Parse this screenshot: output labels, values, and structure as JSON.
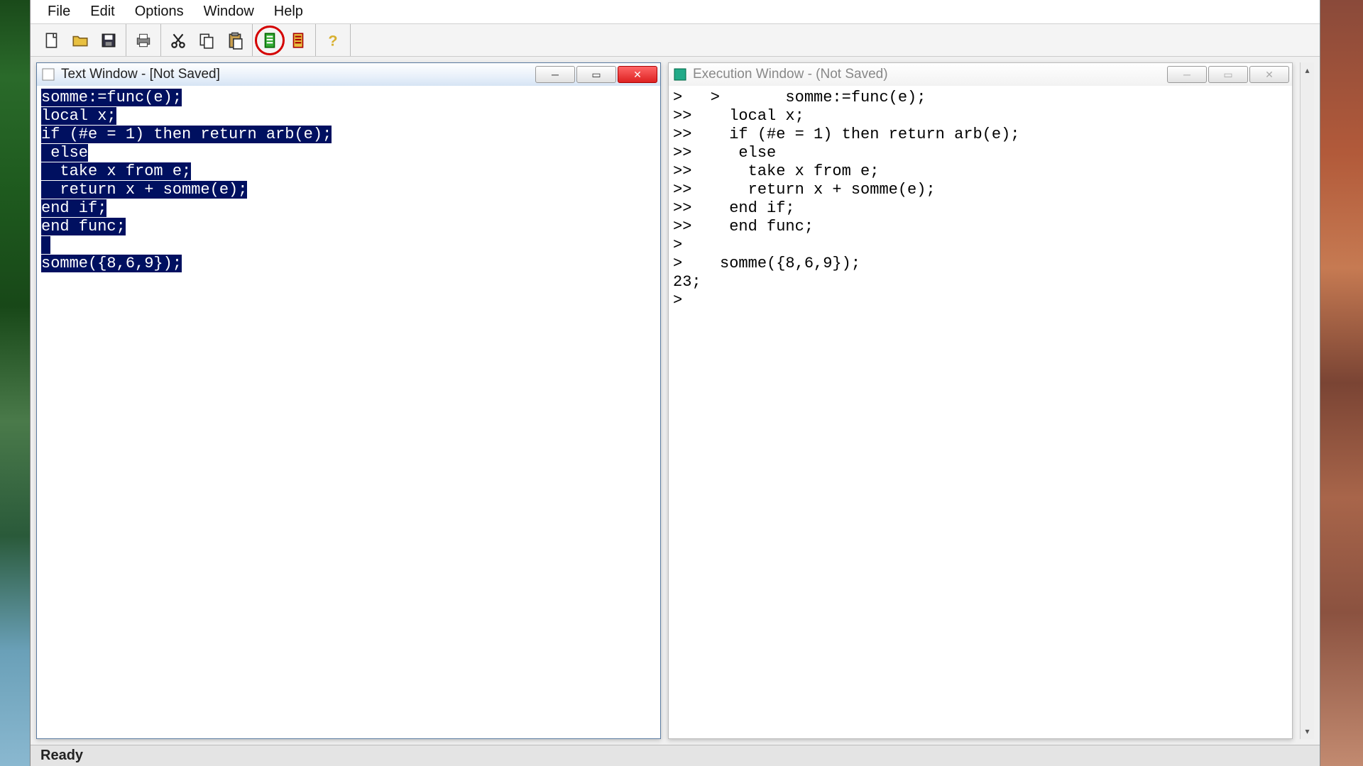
{
  "menu": {
    "file": "File",
    "edit": "Edit",
    "options": "Options",
    "window": "Window",
    "help": "Help"
  },
  "status": "Ready",
  "left_win": {
    "title": "Text Window - [Not Saved]",
    "lines": [
      "somme:=func(e);",
      "local x;",
      "if (#e = 1) then return arb(e);",
      " else",
      "  take x from e;",
      "  return x + somme(e);",
      "end if;",
      "end func;",
      "",
      "somme({8,6,9});"
    ]
  },
  "right_win": {
    "title": "Execution Window - (Not Saved)",
    "lines": [
      ">   >       somme:=func(e);",
      ">>    local x;",
      ">>    if (#e = 1) then return arb(e);",
      ">>     else",
      ">>      take x from e;",
      ">>      return x + somme(e);",
      ">>    end if;",
      ">>    end func;",
      ">",
      ">    somme({8,6,9});",
      "23;",
      ">"
    ]
  }
}
